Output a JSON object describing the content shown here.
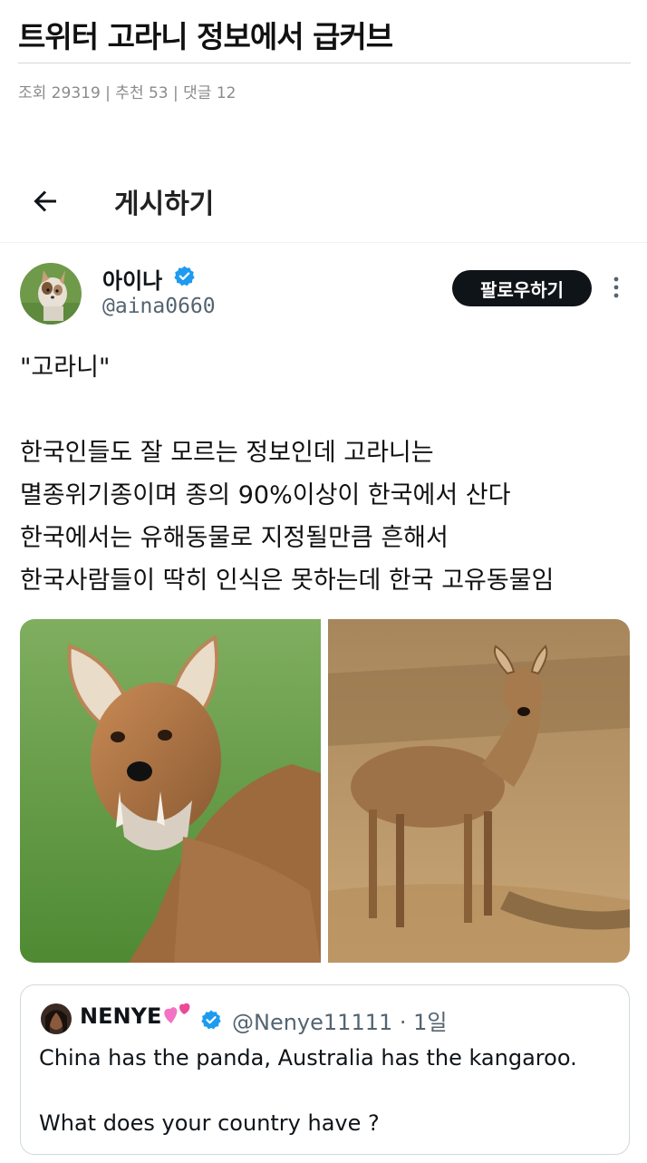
{
  "post": {
    "title": "트위터 고라니 정보에서 급커브",
    "meta": "조회 29319 | 추천 53 | 댓글 12"
  },
  "topbar": {
    "back_icon": "arrow-left-icon",
    "title": "게시하기"
  },
  "tweet": {
    "author_name": "아이나",
    "author_handle": "@aina0660",
    "verified_color": "#1d9bf0",
    "follow_label": "팔로우하기",
    "quote_line": "\"고라니\"",
    "lines": [
      "한국인들도 잘 모르는 정보인데 고라니는",
      "멸종위기종이며 종의 90%이상이 한국에서 산다",
      "한국에서는 유해동물로 지정될만큼 흔해서",
      "한국사람들이 딱히 인식은 못하는데 한국 고유동물임"
    ]
  },
  "quoted": {
    "name": "NENYE",
    "emoji_icon": "hearts-icon",
    "handle_time": "@Nenye11111 · 1일",
    "line1": "China has the panda, Australia has the kangaroo.",
    "line2": "What does your country have ?"
  }
}
